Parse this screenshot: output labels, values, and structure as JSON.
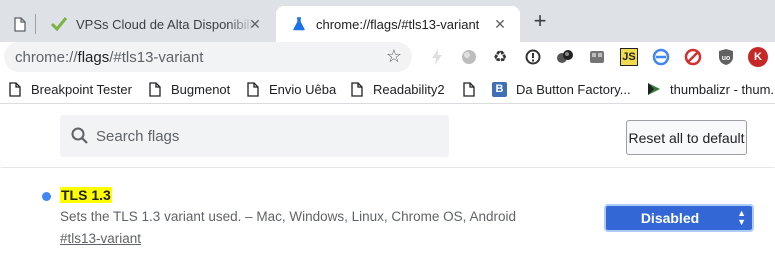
{
  "tabs": [
    {
      "title": "",
      "icon": "page-icon"
    },
    {
      "title": "VPSs Cloud de Alta Disponibilidade",
      "icon": "checkmark-icon"
    },
    {
      "title": "chrome://flags/#tls13-variant",
      "icon": "flask-icon",
      "active": true
    }
  ],
  "omnibox": {
    "scheme": "chrome://",
    "host": "flags",
    "path": "/#tls13-variant"
  },
  "extensions": [
    "lightning-icon",
    "globe-icon",
    "recycle-icon",
    "info-icon",
    "circles-icon",
    "gamepad-icon",
    "js-icon",
    "sync-icon",
    "block-icon",
    "shield-icon",
    "avatar-k-icon"
  ],
  "bookmarks": [
    {
      "label": "Breakpoint Tester",
      "icon": "page-icon"
    },
    {
      "label": "Bugmenot",
      "icon": "page-icon"
    },
    {
      "label": "Envio Uêba",
      "icon": "page-icon"
    },
    {
      "label": "Readability2",
      "icon": "page-icon"
    },
    {
      "label": "Da Button Factory...",
      "icon": "b-logo-icon"
    },
    {
      "label": "thumbalizr - thum...",
      "icon": "thumbalizr-icon"
    }
  ],
  "search": {
    "placeholder": "Search flags"
  },
  "reset_label": "Reset all to default",
  "flag": {
    "name": "TLS 1.3",
    "description": "Sets the TLS 1.3 variant used. – Mac, Windows, Linux, Chrome OS, Android",
    "anchor": "#tls13-variant",
    "selected": "Disabled"
  },
  "colors": {
    "accent": "#3367d6",
    "highlight": "#ffff00",
    "dot": "#4285f4",
    "tabstrip": "#dee1e6"
  }
}
